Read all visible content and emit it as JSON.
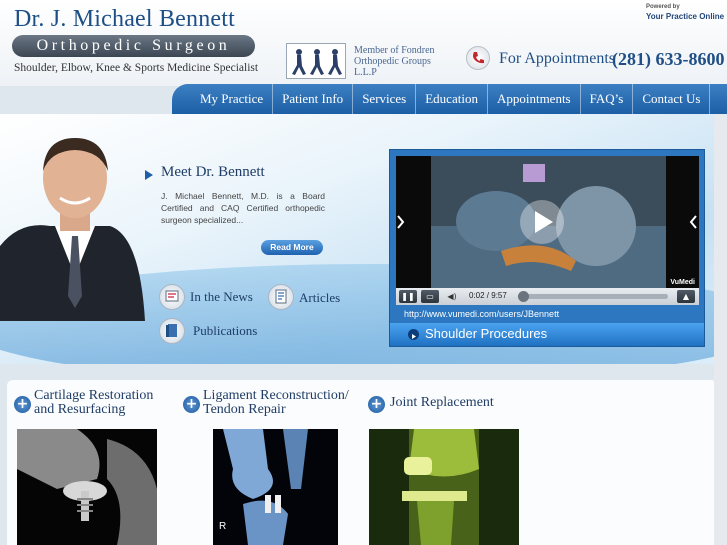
{
  "header": {
    "name": "Dr. J. Michael Bennett",
    "title": "Orthopedic Surgeon",
    "specialty": "Shoulder, Elbow, Knee & Sports Medicine Specialist",
    "group_text": "Member of Fondren Orthopedic Groups L.L.P",
    "appointments_label": "For Appointments",
    "phone": "(281) 633-8600",
    "powered_by": "Powered by",
    "powered_brand": "Your Practice Online"
  },
  "nav": {
    "items": [
      "My Practice",
      "Patient Info",
      "Services",
      "Education",
      "Appointments",
      "FAQ’s",
      "Contact Us"
    ]
  },
  "hero": {
    "meet_title": "Meet Dr. Bennett",
    "meet_desc": "J. Michael Bennett, M.D. is a Board Certified and CAQ Certified orthopedic surgeon specialized...",
    "read_more": "Read More",
    "links": [
      "In the News",
      "Articles",
      "Publications"
    ]
  },
  "video": {
    "time": "0:02 / 9:57",
    "url": "http://www.vumedi.com/users/JBennett",
    "caption": "Shoulder Procedures",
    "badge": "VuMedi",
    "progress_fraction": 0.003
  },
  "procedures": [
    {
      "title_line1": "Cartilage Restoration",
      "title_line2": "and Resurfacing"
    },
    {
      "title_line1": "Ligament Reconstruction/",
      "title_line2": "Tendon Repair"
    },
    {
      "title_line1": "Joint Replacement",
      "title_line2": ""
    }
  ],
  "xray_marker": "R",
  "colors": {
    "brand_blue": "#1d5fa6",
    "nav_blue": "#3c7fc2",
    "accent_blue": "#4ba3f0"
  }
}
